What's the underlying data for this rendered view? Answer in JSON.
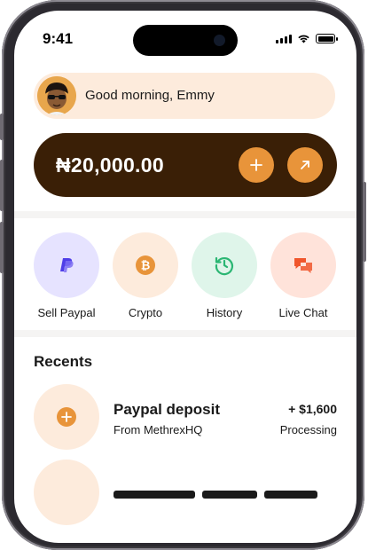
{
  "status_bar": {
    "time": "9:41"
  },
  "greeting": {
    "text": "Good morning, Emmy"
  },
  "balance": {
    "amount": "₦20,000.00"
  },
  "quick_actions": [
    {
      "label": "Sell Paypal",
      "icon": "paypal-icon",
      "bg": "#e6e3ff",
      "fg": "#4f3ee8"
    },
    {
      "label": "Crypto",
      "icon": "bitcoin-icon",
      "bg": "#fdebdc",
      "fg": "#e8943a"
    },
    {
      "label": "History",
      "icon": "history-icon",
      "bg": "#dff5ea",
      "fg": "#2bb673"
    },
    {
      "label": "Live Chat",
      "icon": "chat-icon",
      "bg": "#ffe3da",
      "fg": "#f0562c"
    }
  ],
  "recents": {
    "title": "Recents",
    "items": [
      {
        "title": "Paypal deposit",
        "subtitle": "From MethrexHQ",
        "amount": "+ $1,600",
        "status": "Processing"
      }
    ]
  },
  "colors": {
    "accent": "#e8943a",
    "card_dark": "#3a1f06",
    "greeting_bg": "#fdebdc"
  }
}
